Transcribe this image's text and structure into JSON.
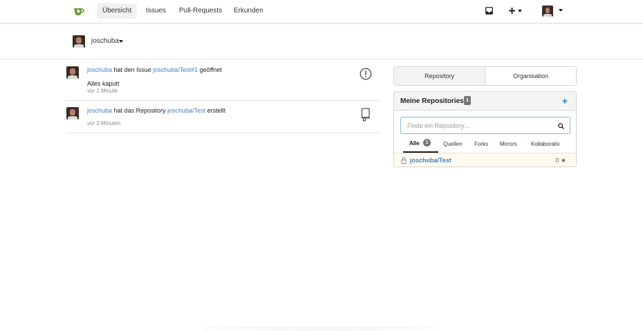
{
  "nav": {
    "items": [
      {
        "label": "Übersicht",
        "active": true
      },
      {
        "label": "Issues",
        "active": false
      },
      {
        "label": "Pull-Requests",
        "active": false
      },
      {
        "label": "Erkunden",
        "active": false
      }
    ],
    "icons": [
      "inbox-icon",
      "plus-icon",
      "user-avatar"
    ],
    "logo_colors": {
      "green": "#609926",
      "white": "#ffffff"
    }
  },
  "context": {
    "user": "joschuba"
  },
  "feed": [
    {
      "user": "joschuba",
      "action": "hat den Issue",
      "target": "joschuba/Test#1",
      "suffix": "geöffnet",
      "comment": "Alles kaputt",
      "time": "vor 1 Minute",
      "icon": "issue-opened-icon"
    },
    {
      "user": "joschuba",
      "action": "hat das Repository",
      "target": "joschuba/Test",
      "suffix": "erstellt",
      "time": "vor 3 Minuten",
      "icon": "repo-icon"
    }
  ],
  "panel": {
    "tabs": [
      {
        "label": "Repository",
        "active": true
      },
      {
        "label": "Organisation",
        "active": false
      }
    ],
    "title": "Meine Repositories",
    "count": "1",
    "search_placeholder": "Finde ein Repository…",
    "filters": [
      {
        "label": "Alle",
        "count": "1",
        "active": true
      },
      {
        "label": "Quellen"
      },
      {
        "label": "Forks"
      },
      {
        "label": "Mirrors"
      },
      {
        "label": "Kollaborativ"
      }
    ],
    "repos": [
      {
        "name": "joschuba/Test",
        "stars": "0",
        "private": true
      }
    ]
  },
  "colors": {
    "link": "#4183c4",
    "accent": "#2185d0",
    "repo_row_bg": "#fffaf0"
  }
}
